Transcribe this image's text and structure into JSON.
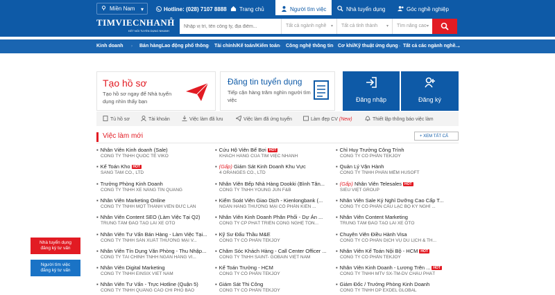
{
  "header": {
    "region": "Miền Nam",
    "hotline": "Hotline: (028) 7107 8888",
    "nav": [
      {
        "label": "Trang chủ",
        "icon": "home-icon"
      },
      {
        "label": "Người tìm việc",
        "icon": "user-icon"
      },
      {
        "label": "Nhà tuyển dụng",
        "icon": "search-user-icon"
      },
      {
        "label": "Góc nghề nghiệp",
        "icon": "career-icon"
      }
    ],
    "logo": {
      "main": "TIMVIECNHANH",
      "sub": "KẾT NỐI TUYỂN DỤNG NHANH",
      "reg": "®"
    }
  },
  "search": {
    "keyword_placeholder": "Nhập vị trí, tên công ty, địa điểm...",
    "industry": "Tất cả ngành nghề",
    "province": "Tất cả tỉnh thành",
    "salary": "Tìm nâng cao"
  },
  "categories": [
    "Kinh doanh",
    "Bán hàng",
    "Lao động phổ thông",
    "Tài chính/Kế toán/Kiểm toán",
    "Công nghệ thông tin",
    "Cơ khí/Kỹ thuật ứng dụng",
    "Tất cả các ngành nghề"
  ],
  "cards": {
    "resume": {
      "title": "Tạo hồ sơ",
      "text": "Tạo hồ sơ ngay để Nhà tuyển dụng nhìn thấy bạn"
    },
    "post": {
      "title": "Đăng tin tuyển dụng",
      "text": "Tiếp cận hàng trăm nghìn người tìm việc"
    },
    "login": "Đăng nhập",
    "register": "Đăng ký"
  },
  "shortcuts": [
    {
      "label": "Tủ hồ sơ",
      "icon": "file-icon"
    },
    {
      "label": "Tài khoản",
      "icon": "account-icon"
    },
    {
      "label": "Việc làm đã lưu",
      "icon": "download-icon"
    },
    {
      "label": "Việc làm đã ứng tuyển",
      "icon": "send-icon"
    },
    {
      "label": "Làm đẹp CV",
      "new": "(New)",
      "icon": "cv-icon"
    },
    {
      "label": "Thiết lập thông báo việc làm",
      "icon": "bell-icon"
    }
  ],
  "section": {
    "title": "Việc làm mới",
    "see_all": "+ XEM TẤT CẢ"
  },
  "jobs": [
    [
      {
        "title": "Nhân Viên Kinh doanh (Sale)",
        "company": "CÔNG TY TNHH QUỐC TẾ VIKO"
      },
      {
        "title": "Kế Toán Kho",
        "hot": "HOT",
        "company": "SANG TAM CO., LTD"
      },
      {
        "title": "Trưởng Phòng Kinh Doanh",
        "company": "CÔNG TY TNHH XE NÂNG TÍN QUANG"
      },
      {
        "title": "Nhân Viên Marketing Online",
        "company": "CÔNG TY TNHH MỘT THÀNH VIÊN ĐỨC LAN"
      },
      {
        "title": "Nhân Viên Content SEO (Làm Việc Tại Q2)",
        "company": "TRUNG TÂM ĐÀO TẠO LÁI XE ÔTÔ"
      },
      {
        "title": "Nhân Viên Tư Vấn Bán Hàng - Làm Việc Tại...",
        "company": "CÔNG TY TNHH SẢN XUẤT THƯƠNG MẠI V..."
      },
      {
        "title": "Nhân Viên Tín Dụng Văn Phòng - Thu Nhập...",
        "company": "CÔNG TY TÀI CHÍNH TNHH NGÂN HÀNG VI..."
      },
      {
        "title": "Nhân Viên Digital Marketing",
        "company": "CÔNG TY TNHH EINSIX VIET NAM"
      },
      {
        "title": "Nhân Viên Tư Vấn - Trực Hotline (Quận 5)",
        "company": "CÔNG TY TNHH QUẢNG CÁO CHI PHÔ BÁO"
      }
    ],
    [
      {
        "title": "Cứu Hộ Viên Bể Bơi",
        "hot": "HOT",
        "company": "KHÁCH HÀNG CỦA TÌM VIỆC NHANH"
      },
      {
        "title": "Giám Sát Kinh Doanh Khu Vực",
        "urgent": "(Gấp)",
        "company": "4 ORANGES CO., LTD"
      },
      {
        "title": "Nhân Viên Bếp Nhà Hàng Dookki (Bình Tân...",
        "company": "CÔNG TY TNHH YOUNG JUN F&B"
      },
      {
        "title": "Kiểm Soát Viên Giao Dịch - Kienlongbank (...",
        "company": "NGÂN HÀNG THƯƠNG MẠI CỔ PHẦN KIÊN ..."
      },
      {
        "title": "Nhân Viên Kinh Doanh Phân Phối - Dự Án ...",
        "company": "CÔNG TY CP PHÁT TRIỂN CÔNG NGHỆ TỐN..."
      },
      {
        "title": "Kỹ Sư Đấu Thầu M&E",
        "company": "CÔNG TY CỔ PHẦN TEKJOY"
      },
      {
        "title": "Chăm Sóc Khách Hàng - Call Center Officer ...",
        "company": "CÔNG TY TNHH SAINT- GOBAIN VIỆT NAM"
      },
      {
        "title": "Kế Toán Trưởng - HCM",
        "company": "CÔNG TY CỔ PHẦN TEKJOY"
      },
      {
        "title": "Giám Sát Thi Công",
        "company": "CÔNG TY CỔ PHẦN TEKJOY"
      }
    ],
    [
      {
        "title": "Chỉ Huy Trưởng Công Trình",
        "company": "CÔNG TY CỔ PHẦN TEKJOY"
      },
      {
        "title": "Quản Lý Vận Hành",
        "company": "CÔNG TY TNHH PHẦN MỀM HUSOFT"
      },
      {
        "title": "Nhân Viên Telesales",
        "urgent": "(Gấp)",
        "hot": "HOT",
        "company": "SIÊU VIỆT GROUP"
      },
      {
        "title": "Nhân Viên Sale Ký Nghỉ Dưỡng Cao Cấp T...",
        "company": "CÔNG TY CỔ PHẦN CẦU LẠC BỘ KỲ NGHỈ ..."
      },
      {
        "title": "Nhân Viên Content Marketing",
        "company": "TRUNG TÂM ĐÀO TẠO LÁI XE ÔTÔ"
      },
      {
        "title": "Chuyên Viên Điều Hành Visa",
        "company": "CÔNG TY CỔ PHẦN DỊCH VỤ DU LỊCH & TH..."
      },
      {
        "title": "Nhân Viên Kế Toán Nội Bộ - HCM",
        "hot": "HOT",
        "company": "CÔNG TY CỔ PHẦN TEKJOY"
      },
      {
        "title": "Nhân Viên Kinh Doanh - Lương Trên ...",
        "hot": "HOT",
        "company": "CÔNG TY TNHH MTV SX-TM-DV CHÂU PHÁT"
      },
      {
        "title": "Giám Đốc / Trưởng Phòng Kinh Doanh",
        "company": "CÔNG TY TNHH DP EXDEL GLOBAL"
      }
    ]
  ],
  "float_buttons": {
    "employer": [
      "Nhà tuyển dụng",
      "đăng ký tư vấn"
    ],
    "seeker": [
      "Người tìm việc",
      "đăng ký tư vấn"
    ]
  },
  "colors": {
    "brand": "#0e5aa7",
    "accent": "#e21b23"
  }
}
